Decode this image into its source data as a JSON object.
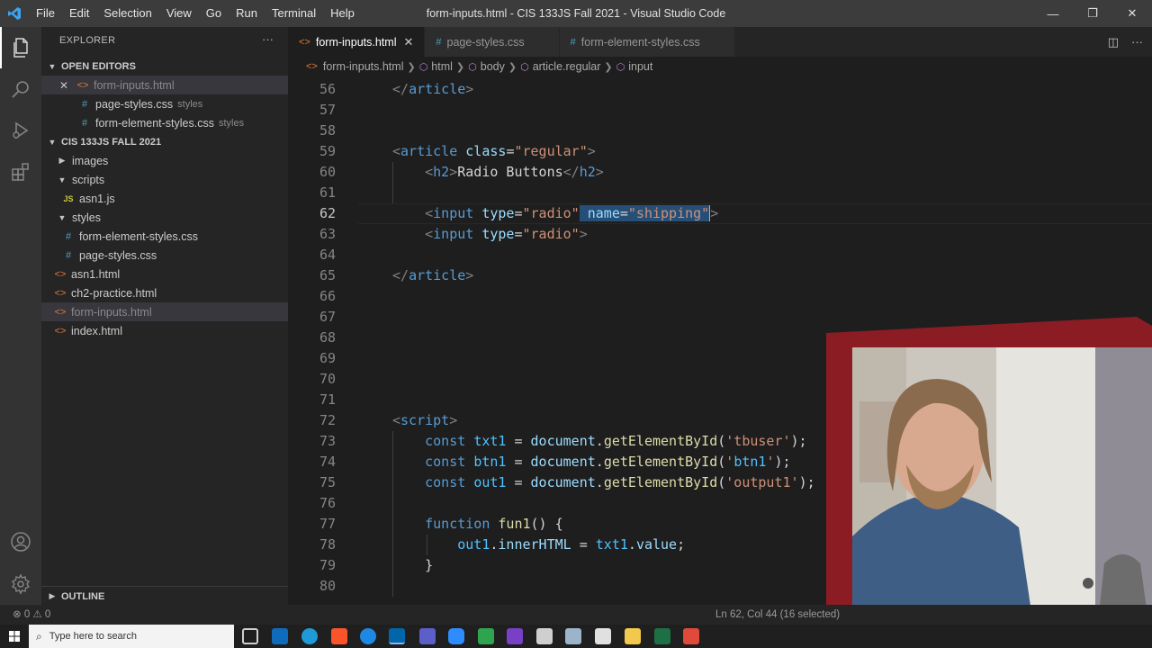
{
  "window": {
    "title": "form-inputs.html - CIS 133JS Fall 2021 - Visual Studio Code",
    "menu": [
      "File",
      "Edit",
      "Selection",
      "View",
      "Go",
      "Run",
      "Terminal",
      "Help"
    ],
    "controls": [
      "minimize",
      "restore",
      "close"
    ]
  },
  "activity_bar": [
    "files-icon",
    "search-icon",
    "run-debug-icon",
    "extensions-icon",
    "account-icon",
    "settings-gear-icon"
  ],
  "sidebar": {
    "header": "EXPLORER",
    "more": "···",
    "open_editors": {
      "title": "OPEN EDITORS",
      "items": [
        {
          "name": "form-inputs.html",
          "type": "html",
          "suffix": ""
        },
        {
          "name": "page-styles.css",
          "type": "css",
          "suffix": "styles"
        },
        {
          "name": "form-element-styles.css",
          "type": "css",
          "suffix": "styles"
        }
      ]
    },
    "project": {
      "title": "CIS 133JS FALL 2021",
      "tree": [
        {
          "name": "images",
          "kind": "folder-collapsed"
        },
        {
          "name": "scripts",
          "kind": "folder-open"
        },
        {
          "name": "asn1.js",
          "kind": "js"
        },
        {
          "name": "styles",
          "kind": "folder-open"
        },
        {
          "name": "form-element-styles.css",
          "kind": "css"
        },
        {
          "name": "page-styles.css",
          "kind": "css"
        },
        {
          "name": "asn1.html",
          "kind": "html"
        },
        {
          "name": "ch2-practice.html",
          "kind": "html"
        },
        {
          "name": "form-inputs.html",
          "kind": "html"
        },
        {
          "name": "index.html",
          "kind": "html"
        }
      ]
    },
    "outline": "OUTLINE"
  },
  "tabs": [
    {
      "label": "form-inputs.html",
      "type": "html",
      "active": true
    },
    {
      "label": "page-styles.css",
      "type": "css",
      "active": false
    },
    {
      "label": "form-element-styles.css",
      "type": "css",
      "active": false
    }
  ],
  "breadcrumbs": [
    "form-inputs.html",
    "html",
    "body",
    "article.regular",
    "input"
  ],
  "editor": {
    "lines": [
      {
        "n": "56",
        "code": "</article>"
      },
      {
        "n": "57",
        "code": ""
      },
      {
        "n": "58",
        "code": ""
      },
      {
        "n": "59",
        "code": "<article class=\"regular\">"
      },
      {
        "n": "60",
        "code": "    <h2>Radio Buttons</h2>"
      },
      {
        "n": "61",
        "code": ""
      },
      {
        "n": "62",
        "code": "    <input type=\"radio\" name=\"shipping\">"
      },
      {
        "n": "63",
        "code": "    <input type=\"radio\">"
      },
      {
        "n": "64",
        "code": ""
      },
      {
        "n": "65",
        "code": "</article>"
      },
      {
        "n": "66",
        "code": ""
      },
      {
        "n": "67",
        "code": ""
      },
      {
        "n": "68",
        "code": ""
      },
      {
        "n": "69",
        "code": ""
      },
      {
        "n": "70",
        "code": ""
      },
      {
        "n": "71",
        "code": ""
      },
      {
        "n": "72",
        "code": "<script>"
      },
      {
        "n": "73",
        "code": "    const txt1 = document.getElementById('tbuser');"
      },
      {
        "n": "74",
        "code": "    const btn1 = document.getElementById('btn1');"
      },
      {
        "n": "75",
        "code": "    const out1 = document.getElementById('output1');"
      },
      {
        "n": "76",
        "code": ""
      },
      {
        "n": "77",
        "code": "    function fun1() {"
      },
      {
        "n": "78",
        "code": "        out1.innerHTML = txt1.value;"
      },
      {
        "n": "79",
        "code": "    }"
      },
      {
        "n": "80",
        "code": ""
      }
    ],
    "current_line": "62",
    "selection": " name=\"shipping\""
  },
  "statusbar": {
    "problems": "⊗ 0 ⚠ 0",
    "position": "Ln 62, Col 44 (16 selected)"
  },
  "taskbar": {
    "search_placeholder": "Type here to search"
  }
}
